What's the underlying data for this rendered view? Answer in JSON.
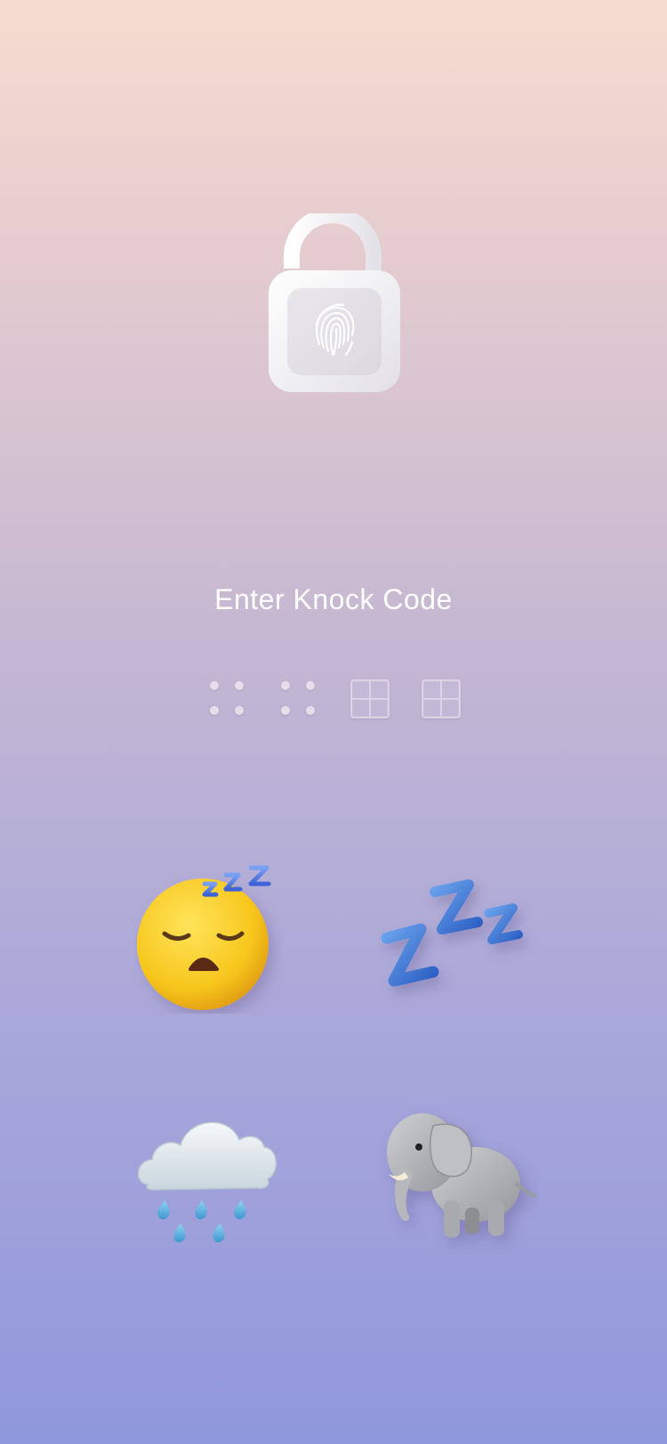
{
  "screen": {
    "title": "Enter Knock Code",
    "background_gradient": [
      "#f6dccf",
      "#c3b6d3",
      "#8f97dc"
    ]
  },
  "lock": {
    "icon": "padlock-fingerprint-icon",
    "state": "unlocked",
    "color": "#ffffff"
  },
  "progress": {
    "total_steps": 4,
    "entered_steps": 2,
    "items": [
      {
        "icon": "dots-pattern-icon",
        "state": "entered"
      },
      {
        "icon": "dots-pattern-icon",
        "state": "entered"
      },
      {
        "icon": "grid-empty-icon",
        "state": "empty"
      },
      {
        "icon": "grid-empty-icon",
        "state": "empty"
      }
    ]
  },
  "knock_pad": {
    "cells": [
      {
        "icon": "sleeping-face-icon",
        "position": "top-left"
      },
      {
        "icon": "zzz-icon",
        "position": "top-right"
      },
      {
        "icon": "cloud-with-rain-icon",
        "position": "bottom-left"
      },
      {
        "icon": "elephant-icon",
        "position": "bottom-right"
      }
    ]
  }
}
